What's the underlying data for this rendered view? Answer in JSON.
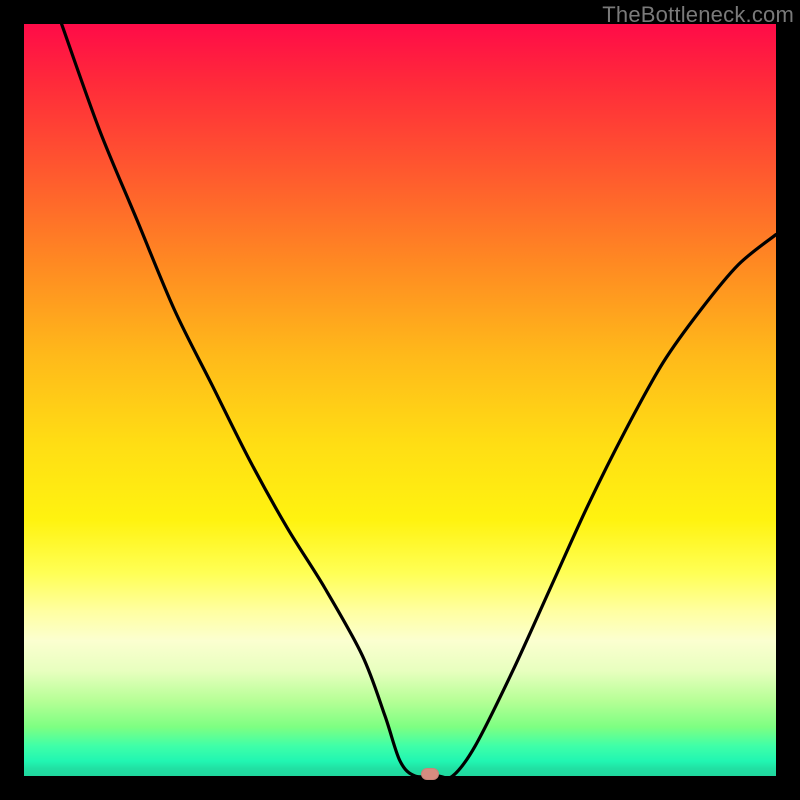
{
  "watermark": "TheBottleneck.com",
  "chart_data": {
    "type": "line",
    "title": "",
    "xlabel": "",
    "ylabel": "",
    "xlim": [
      0,
      100
    ],
    "ylim": [
      0,
      100
    ],
    "grid": false,
    "legend": false,
    "series": [
      {
        "name": "bottleneck-curve",
        "x": [
          5,
          10,
          15,
          20,
          25,
          30,
          35,
          40,
          45,
          48,
          50,
          52,
          55,
          57,
          60,
          65,
          70,
          75,
          80,
          85,
          90,
          95,
          100
        ],
        "y": [
          100,
          86,
          74,
          62,
          52,
          42,
          33,
          25,
          16,
          8,
          2,
          0,
          0,
          0,
          4,
          14,
          25,
          36,
          46,
          55,
          62,
          68,
          72
        ]
      }
    ],
    "annotations": [
      {
        "name": "optimal-marker",
        "x": 54,
        "y": 0
      }
    ],
    "gradient_stops": [
      {
        "pos": 0.0,
        "color": "#ff0b48"
      },
      {
        "pos": 0.5,
        "color": "#ffde14"
      },
      {
        "pos": 0.8,
        "color": "#ffffa0"
      },
      {
        "pos": 1.0,
        "color": "#1fd79e"
      }
    ]
  }
}
